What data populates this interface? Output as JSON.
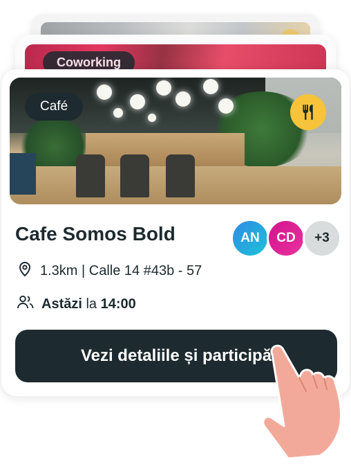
{
  "stack": {
    "mid_tag": "Coworking"
  },
  "card": {
    "category": "Café",
    "category_icon": "fork-knife-icon",
    "name": "Cafe Somos Bold",
    "attendees": {
      "avatars": [
        "AN",
        "CD"
      ],
      "more": "+3"
    },
    "location": {
      "icon": "location-pin-icon",
      "text": "1.3km | Calle 14 #43b - 57"
    },
    "time": {
      "icon": "people-icon",
      "day": "Astăzi",
      "connector": "la",
      "hour": "14:00"
    },
    "cta_label": "Vezi detaliile și participă"
  },
  "colors": {
    "dark": "#1d2a2f",
    "accent_yellow": "#f6c33a",
    "avatar_blue": "#2f8be6",
    "avatar_pink": "#d3138d",
    "avatar_grey": "#d9dcdc",
    "coworking_red": "#e0204e",
    "hand_skin": "#f2a99a"
  }
}
